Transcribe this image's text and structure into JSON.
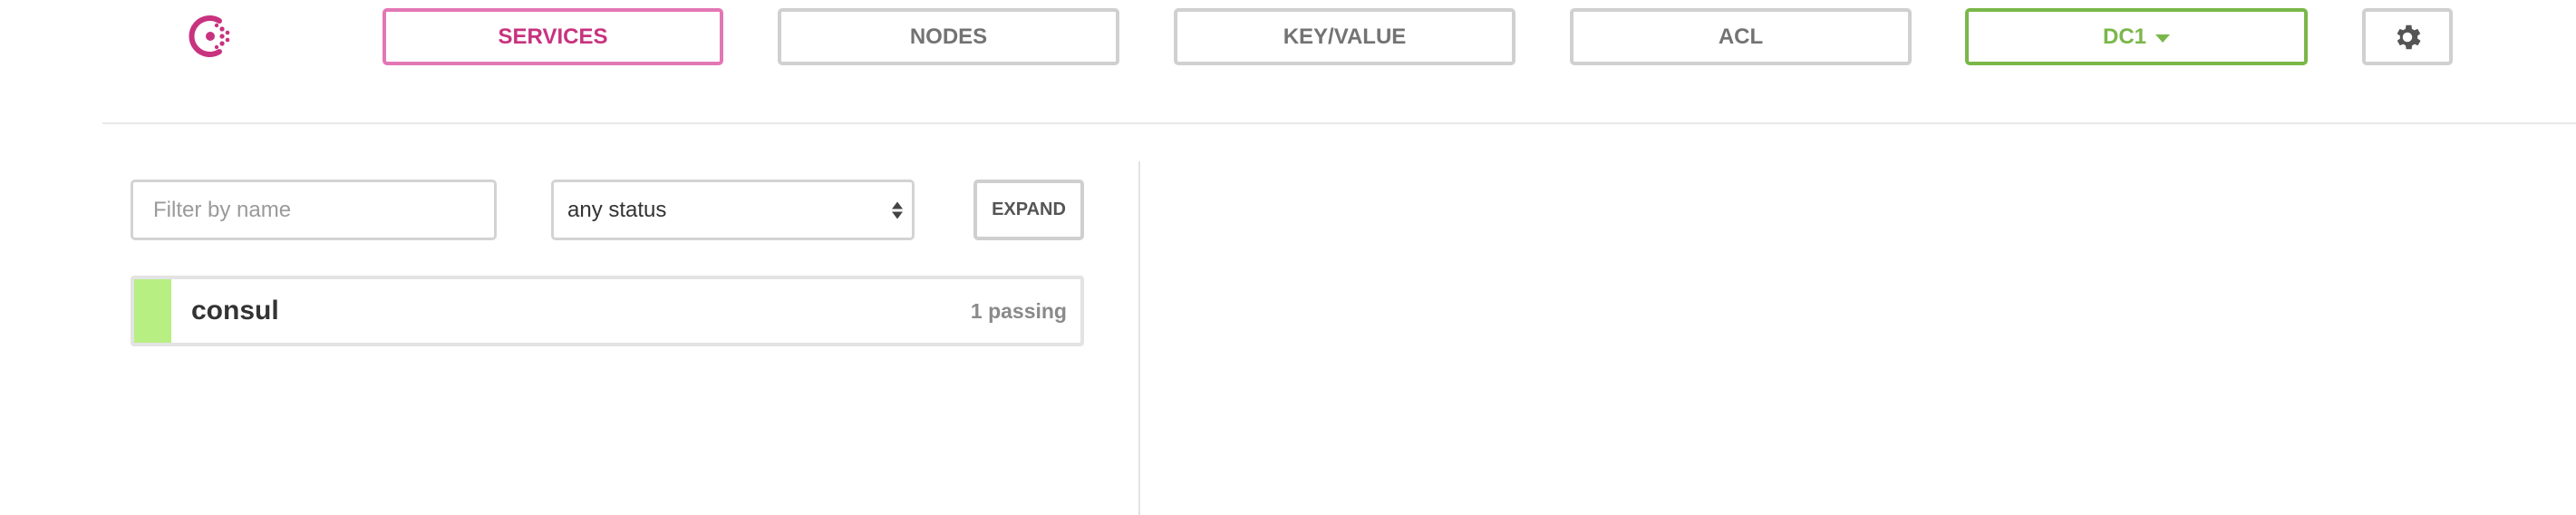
{
  "colors": {
    "brand": "#c8327e",
    "active_border": "#e377b5",
    "datacenter": "#7ab749",
    "passing": "#b7ef83",
    "border": "#d0d0d0",
    "text_muted": "#737373"
  },
  "logo": {
    "icon": "consul-logo-icon"
  },
  "nav": {
    "services": "SERVICES",
    "nodes": "NODES",
    "key_value": "KEY/VALUE",
    "acl": "ACL",
    "datacenter": "DC1",
    "settings_icon": "gear-icon"
  },
  "filters": {
    "name_placeholder": "Filter by name",
    "name_value": "",
    "status_selected": "any status",
    "expand_label": "EXPAND"
  },
  "services": [
    {
      "name": "consul",
      "checks": "1 passing",
      "status": "passing"
    }
  ]
}
